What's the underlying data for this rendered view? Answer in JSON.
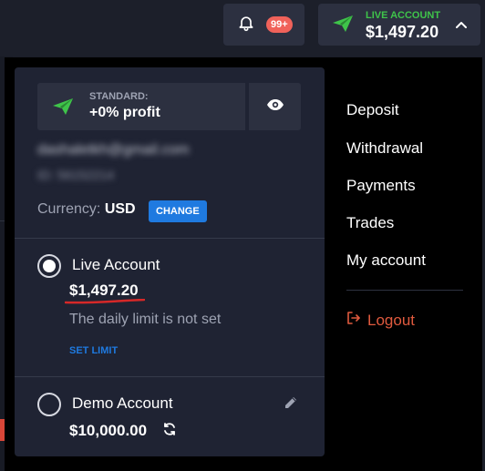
{
  "header": {
    "notifications_badge": "99+",
    "account_label": "LIVE ACCOUNT",
    "account_balance": "$1,497.20"
  },
  "card": {
    "tier_label": "STANDARD:",
    "tier_value": "+0% profit",
    "email": "dashaletkh@gmail.com",
    "user_id": "ID: 56152214",
    "currency_label": "Currency:",
    "currency_value": "USD",
    "change_label": "CHANGE",
    "live": {
      "title": "Live Account",
      "balance": "$1,497.20",
      "limit_text": "The daily limit is not set",
      "set_limit_label": "SET LIMIT"
    },
    "demo": {
      "title": "Demo Account",
      "balance": "$10,000.00"
    }
  },
  "side_menu": {
    "items": [
      "Deposit",
      "Withdrawal",
      "Payments",
      "Trades",
      "My account"
    ],
    "logout": "Logout"
  },
  "colors": {
    "accent_green": "#3fc44a",
    "accent_blue": "#1f7ae0",
    "logout_red": "#e05a3e",
    "badge_red": "#f0625a"
  }
}
